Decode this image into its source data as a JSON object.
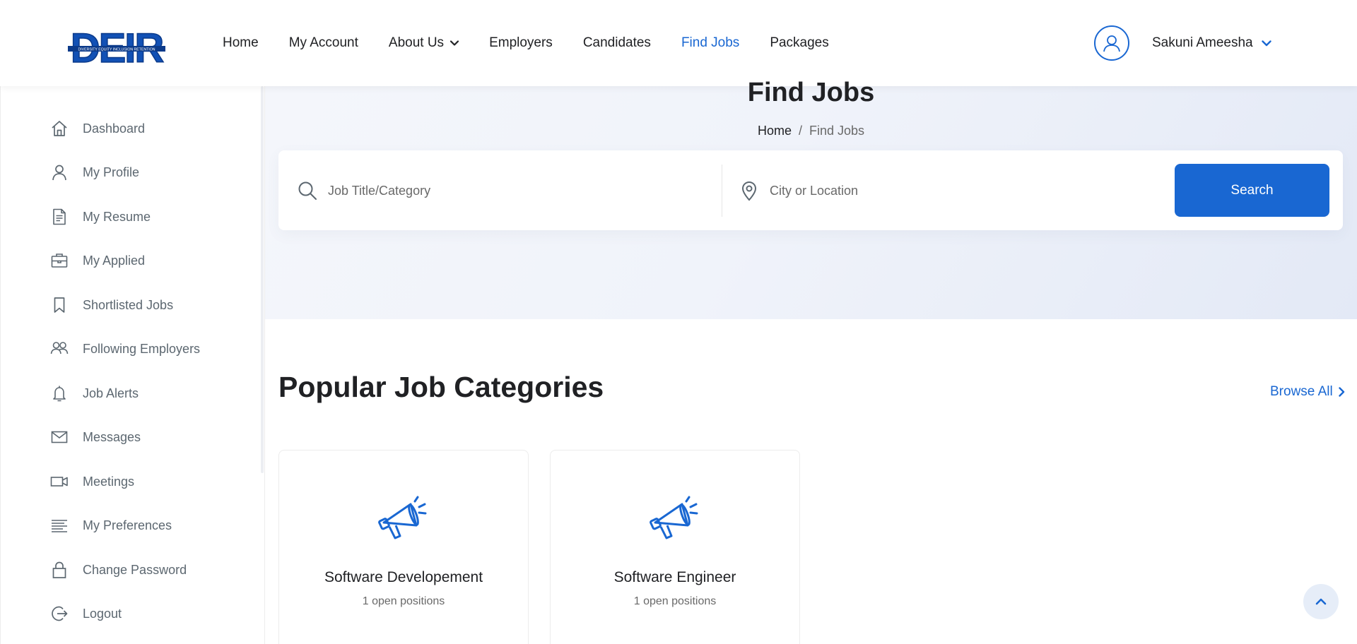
{
  "colors": {
    "accent": "#1967d2",
    "text": "#202124",
    "muted": "#696969"
  },
  "header": {
    "logo": {
      "text": "DEIR",
      "tagline": "DIVERSITY EQUITY INCLUSION RETENTION"
    },
    "nav": [
      {
        "label": "Home"
      },
      {
        "label": "My Account"
      },
      {
        "label": "About Us",
        "has_dropdown": true
      },
      {
        "label": "Employers"
      },
      {
        "label": "Candidates"
      },
      {
        "label": "Find Jobs",
        "active": true
      },
      {
        "label": "Packages"
      }
    ],
    "user": {
      "name": "Sakuni Ameesha",
      "icon": "user-avatar-icon"
    }
  },
  "sidebar": {
    "items": [
      {
        "label": "Dashboard",
        "icon": "home-icon"
      },
      {
        "label": "My Profile",
        "icon": "user-icon"
      },
      {
        "label": "My Resume",
        "icon": "document-icon"
      },
      {
        "label": "My Applied",
        "icon": "briefcase-icon"
      },
      {
        "label": "Shortlisted Jobs",
        "icon": "bookmark-icon"
      },
      {
        "label": "Following Employers",
        "icon": "users-icon"
      },
      {
        "label": "Job Alerts",
        "icon": "bell-icon"
      },
      {
        "label": "Messages",
        "icon": "envelope-icon"
      },
      {
        "label": "Meetings",
        "icon": "video-icon"
      },
      {
        "label": "My Preferences",
        "icon": "lines-icon"
      },
      {
        "label": "Change Password",
        "icon": "lock-icon"
      },
      {
        "label": "Logout",
        "icon": "logout-icon"
      }
    ]
  },
  "banner": {
    "title": "Find Jobs",
    "breadcrumb": {
      "home": "Home",
      "separator": "/",
      "current": "Find Jobs"
    },
    "search": {
      "job_placeholder": "Job Title/Category",
      "location_placeholder": "City or Location",
      "button_label": "Search"
    }
  },
  "categories": {
    "title": "Popular Job Categories",
    "browse_all": "Browse All",
    "items": [
      {
        "title": "Software Developement",
        "count": "1 open positions",
        "icon": "megaphone-icon"
      },
      {
        "title": "Software Engineer",
        "count": "1 open positions",
        "icon": "megaphone-icon"
      }
    ]
  }
}
